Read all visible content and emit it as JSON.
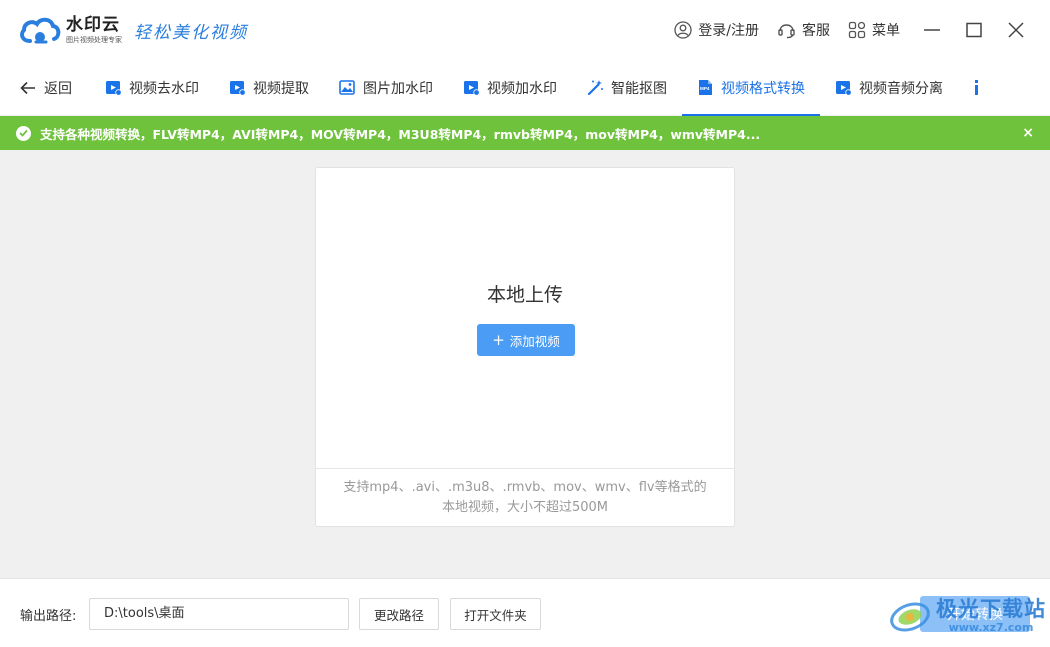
{
  "app": {
    "name": "水印云",
    "subtitle": "图片视频处理专家",
    "slogan": "轻松美化视频"
  },
  "header": {
    "login_label": "登录/注册",
    "service_label": "客服",
    "menu_label": "菜单"
  },
  "nav": {
    "back_label": "返回",
    "items": [
      {
        "label": "视频去水印",
        "icon": "video-remove-icon"
      },
      {
        "label": "视频提取",
        "icon": "video-extract-icon"
      },
      {
        "label": "图片加水印",
        "icon": "image-watermark-icon"
      },
      {
        "label": "视频加水印",
        "icon": "video-watermark-icon"
      },
      {
        "label": "智能抠图",
        "icon": "magic-wand-icon"
      },
      {
        "label": "视频格式转换",
        "icon": "mp4-file-icon",
        "active": true
      },
      {
        "label": "视频音频分离",
        "icon": "video-audio-icon"
      }
    ]
  },
  "banner": {
    "text": "支持各种视频转换，FLV转MP4，AVI转MP4，MOV转MP4，M3U8转MP4，rmvb转MP4，mov转MP4，wmv转MP4...",
    "close": "×"
  },
  "upload": {
    "title": "本地上传",
    "add_button": "添加视频",
    "hint_line1": "支持mp4、.avi、.m3u8、.rmvb、mov、wmv、flv等格式的",
    "hint_line2": "本地视频，大小不超过500M"
  },
  "output": {
    "label": "输出路径:",
    "path": "D:\\tools\\桌面",
    "change_button": "更改路径",
    "open_button": "打开文件夹",
    "start_button": "开始转换"
  },
  "watermark": {
    "name": "极光下载站",
    "url": "www.xz7.com"
  },
  "colors": {
    "accent": "#1a73e8",
    "banner": "#6fc23b",
    "button": "#4a9cf5"
  }
}
